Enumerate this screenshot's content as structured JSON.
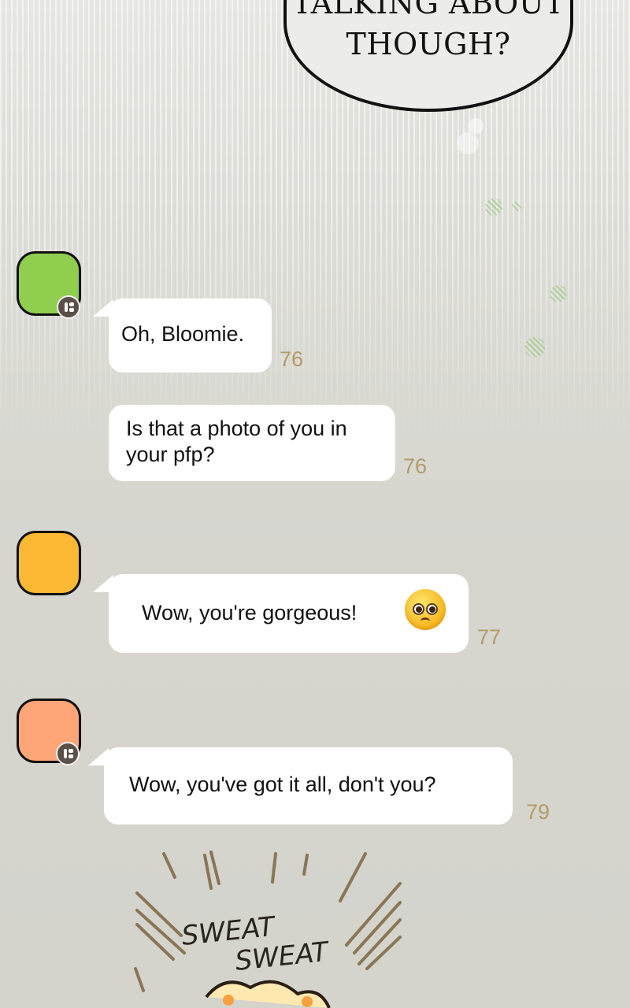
{
  "speech_bubble": {
    "line1": "TALKING ABOUT",
    "line2": "THOUGH?"
  },
  "messages": [
    {
      "sender_color": "#8fce4e",
      "has_badge": true,
      "text_lines": [
        "Oh, Bloomie."
      ],
      "count": "76"
    },
    {
      "sender_color": null,
      "has_badge": false,
      "text_lines": [
        "Is that a photo of you in",
        "your pfp?"
      ],
      "count": "76"
    },
    {
      "sender_color": "#fdb934",
      "has_badge": false,
      "text_lines": [
        "Wow, you're gorgeous!"
      ],
      "emoji": "pleading-face-icon",
      "count": "77"
    },
    {
      "sender_color": "#ffa679",
      "has_badge": true,
      "text_lines": [
        "Wow, you've got it all, don't you?"
      ],
      "count": "79"
    }
  ],
  "sound_effect": {
    "word1": "SWEAT",
    "word2": "SWEAT"
  },
  "colors": {
    "background": "#d6d6cf",
    "count_text": "#b29a6a",
    "bubble": "#ffffff"
  }
}
